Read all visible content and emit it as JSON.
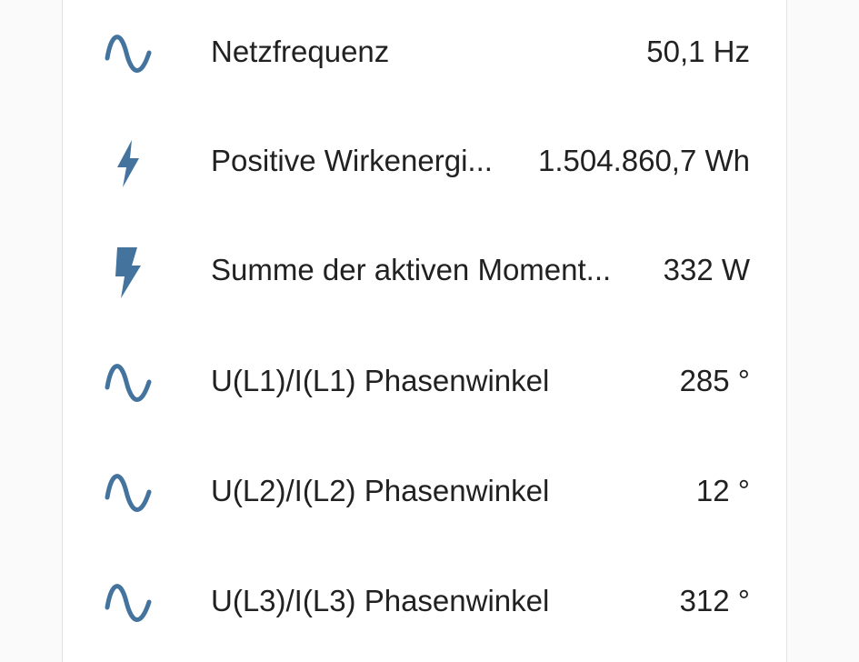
{
  "accent_color": "#44739e",
  "entities": [
    {
      "icon": "sine-wave-icon",
      "name": "Netzfrequenz",
      "value": "50,1 Hz"
    },
    {
      "icon": "flash-icon",
      "name": "Positive Wirkenergi...",
      "value": "1.504.860,7 Wh"
    },
    {
      "icon": "flash-bold-icon",
      "name": "Summe der aktiven Moment...",
      "value": "332 W"
    },
    {
      "icon": "sine-wave-icon",
      "name": "U(L1)/I(L1) Phasenwinkel",
      "value": "285 °"
    },
    {
      "icon": "sine-wave-icon",
      "name": "U(L2)/I(L2) Phasenwinkel",
      "value": "12 °"
    },
    {
      "icon": "sine-wave-icon",
      "name": "U(L3)/I(L3) Phasenwinkel",
      "value": "312 °"
    }
  ]
}
